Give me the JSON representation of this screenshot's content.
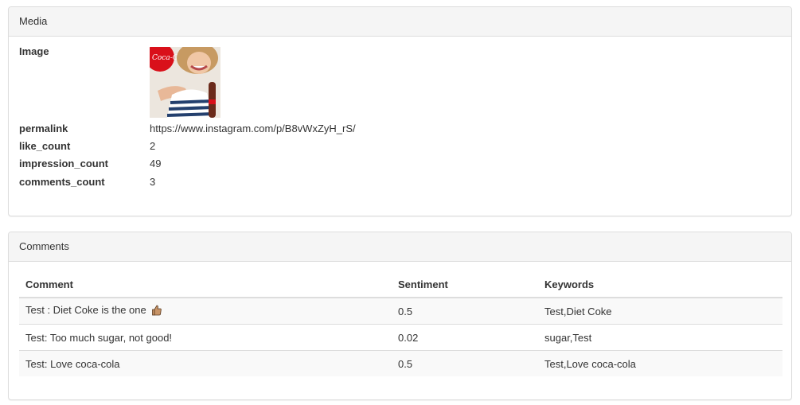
{
  "media_panel": {
    "title": "Media",
    "image_label": "Image",
    "image_brand_text": "Coca-Cola",
    "fields": [
      {
        "label": "permalink",
        "value": "https://www.instagram.com/p/B8vWxZyH_rS/"
      },
      {
        "label": "like_count",
        "value": "2"
      },
      {
        "label": "impression_count",
        "value": "49"
      },
      {
        "label": "comments_count",
        "value": "3"
      }
    ]
  },
  "comments_panel": {
    "title": "Comments",
    "headers": {
      "comment": "Comment",
      "sentiment": "Sentiment",
      "keywords": "Keywords"
    },
    "rows": [
      {
        "comment": "Test : Diet Coke is the one",
        "emoji": "thumbs-up-icon",
        "sentiment": "0.5",
        "keywords": "Test,Diet Coke"
      },
      {
        "comment": "Test: Too much sugar, not good!",
        "sentiment": "0.02",
        "keywords": "sugar,Test"
      },
      {
        "comment": "Test: Love coca-cola",
        "sentiment": "0.5",
        "keywords": "Test,Love coca-cola"
      }
    ]
  },
  "colors": {
    "panel_heading_bg": "#f5f5f5",
    "border": "#dddddd",
    "coke_red": "#d9101a"
  }
}
